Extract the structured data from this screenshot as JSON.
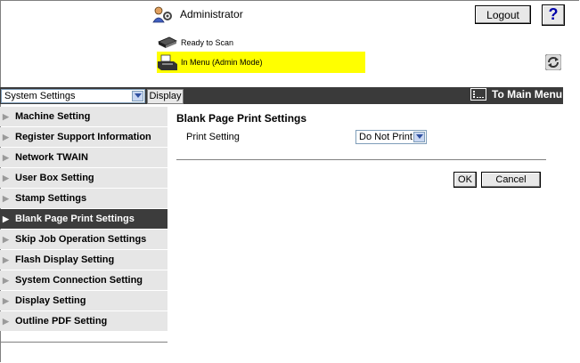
{
  "header": {
    "user": "Administrator",
    "logout_label": "Logout",
    "help_label": "?"
  },
  "status": {
    "line1": "Ready to Scan",
    "line2": "In Menu (Admin Mode)",
    "highlight_color": "#ffff00"
  },
  "nav": {
    "select_value": "System Settings",
    "display_label": "Display",
    "main_menu_label": "To Main Menu"
  },
  "sidebar": {
    "items": [
      {
        "label": "Machine Setting"
      },
      {
        "label": "Register Support Information"
      },
      {
        "label": "Network TWAIN"
      },
      {
        "label": "User Box Setting"
      },
      {
        "label": "Stamp Settings"
      },
      {
        "label": "Blank Page Print Settings",
        "active": true
      },
      {
        "label": "Skip Job Operation Settings"
      },
      {
        "label": "Flash Display Setting"
      },
      {
        "label": "System Connection Setting"
      },
      {
        "label": "Display Setting"
      },
      {
        "label": "Outline PDF Setting"
      }
    ]
  },
  "main": {
    "title": "Blank Page Print Settings",
    "field_label": "Print Setting",
    "field_value": "Do Not Print",
    "ok_label": "OK",
    "cancel_label": "Cancel"
  },
  "icons": {
    "user": "admin-user-icon",
    "status_ready": "scanner-icon",
    "status_menu": "printer-icon",
    "refresh": "refresh-icon",
    "main_menu": "main-menu-icon"
  }
}
